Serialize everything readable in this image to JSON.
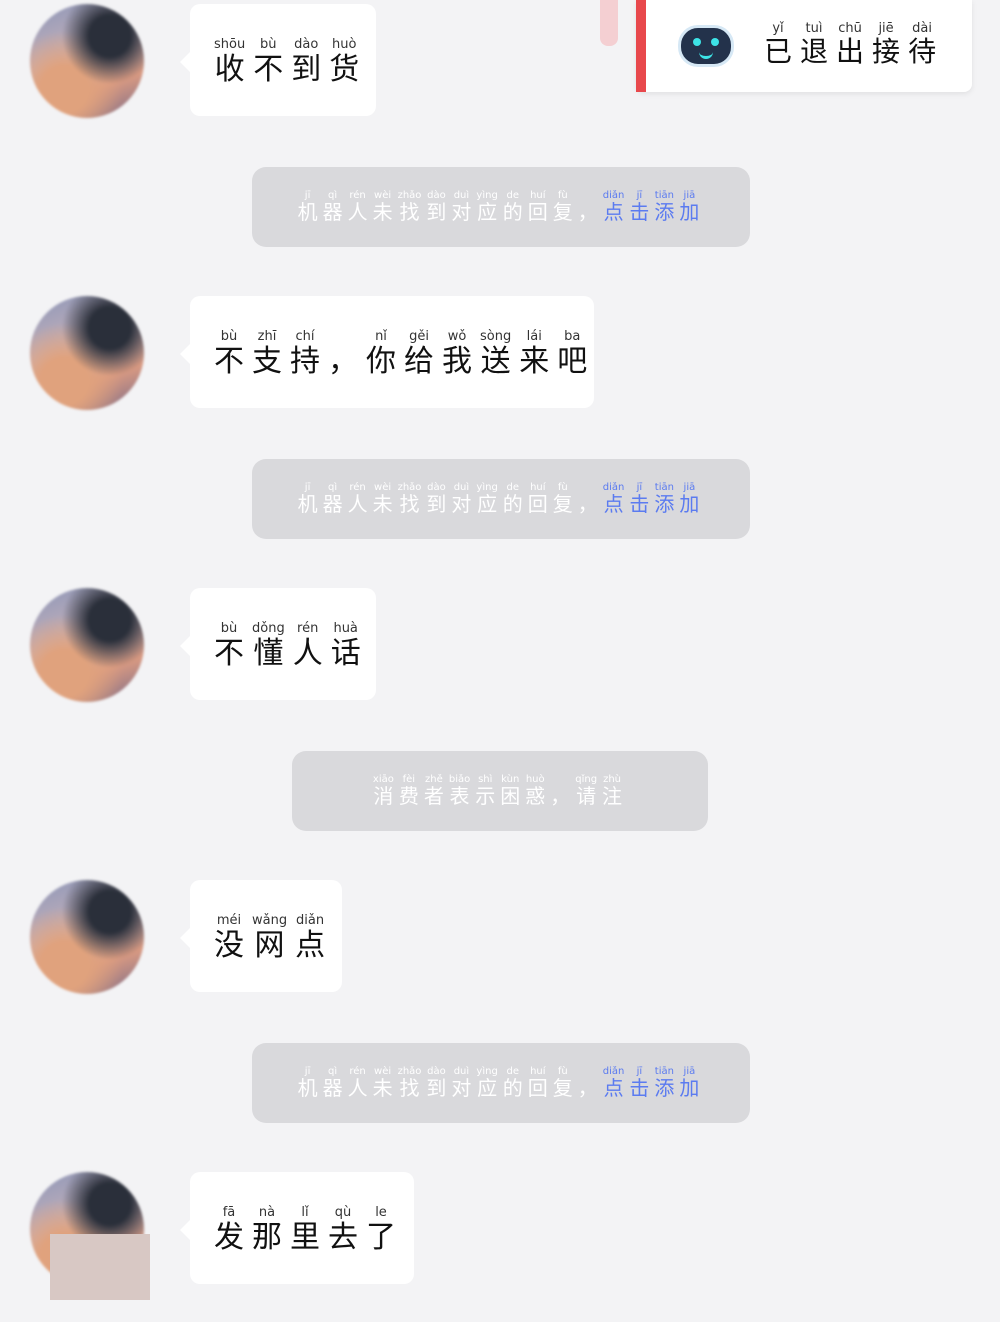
{
  "status_card": {
    "accent": "#e8484c",
    "icon": "robot-icon",
    "text": [
      [
        "已",
        "yǐ"
      ],
      [
        "退",
        "tuì"
      ],
      [
        "出",
        "chū"
      ],
      [
        "接",
        "jiē"
      ],
      [
        "待",
        "dài"
      ]
    ]
  },
  "messages": [
    {
      "type": "user",
      "text": [
        [
          "收",
          "shōu"
        ],
        [
          "不",
          "bù"
        ],
        [
          "到",
          "dào"
        ],
        [
          "货",
          "huò"
        ]
      ]
    },
    {
      "type": "system",
      "text": [
        [
          "机",
          "jī"
        ],
        [
          "器",
          "qì"
        ],
        [
          "人",
          "rén"
        ],
        [
          "未",
          "wèi"
        ],
        [
          "找",
          "zhǎo"
        ],
        [
          "到",
          "dào"
        ],
        [
          "对",
          "duì"
        ],
        [
          "应",
          "yìng"
        ],
        [
          "的",
          "de"
        ],
        [
          "回",
          "huí"
        ],
        [
          "复",
          "fù"
        ],
        [
          "，",
          ""
        ]
      ],
      "link": [
        [
          "点",
          "diǎn"
        ],
        [
          "击",
          "jī"
        ],
        [
          "添",
          "tiān"
        ],
        [
          "加",
          "jiā"
        ]
      ]
    },
    {
      "type": "user",
      "text": [
        [
          "不",
          "bù"
        ],
        [
          "支",
          "zhī"
        ],
        [
          "持",
          "chí"
        ],
        [
          "，",
          ""
        ],
        [
          "你",
          "nǐ"
        ],
        [
          "给",
          "gěi"
        ],
        [
          "我",
          "wǒ"
        ],
        [
          "送",
          "sòng"
        ],
        [
          "来",
          "lái"
        ],
        [
          "吧",
          "ba"
        ]
      ]
    },
    {
      "type": "system",
      "text": [
        [
          "机",
          "jī"
        ],
        [
          "器",
          "qì"
        ],
        [
          "人",
          "rén"
        ],
        [
          "未",
          "wèi"
        ],
        [
          "找",
          "zhǎo"
        ],
        [
          "到",
          "dào"
        ],
        [
          "对",
          "duì"
        ],
        [
          "应",
          "yìng"
        ],
        [
          "的",
          "de"
        ],
        [
          "回",
          "huí"
        ],
        [
          "复",
          "fù"
        ],
        [
          "，",
          ""
        ]
      ],
      "link": [
        [
          "点",
          "diǎn"
        ],
        [
          "击",
          "jī"
        ],
        [
          "添",
          "tiān"
        ],
        [
          "加",
          "jiā"
        ]
      ]
    },
    {
      "type": "user",
      "text": [
        [
          "不",
          "bù"
        ],
        [
          "懂",
          "dǒng"
        ],
        [
          "人",
          "rén"
        ],
        [
          "话",
          "huà"
        ]
      ]
    },
    {
      "type": "system",
      "text": [
        [
          "消",
          "xiāo"
        ],
        [
          "费",
          "fèi"
        ],
        [
          "者",
          "zhě"
        ],
        [
          "表",
          "biǎo"
        ],
        [
          "示",
          "shì"
        ],
        [
          "困",
          "kùn"
        ],
        [
          "惑",
          "huò"
        ],
        [
          "，",
          ""
        ],
        [
          "请",
          "qǐng"
        ],
        [
          "注",
          "zhù"
        ]
      ],
      "link": []
    },
    {
      "type": "user",
      "text": [
        [
          "没",
          "méi"
        ],
        [
          "网",
          "wǎng"
        ],
        [
          "点",
          "diǎn"
        ]
      ]
    },
    {
      "type": "system",
      "text": [
        [
          "机",
          "jī"
        ],
        [
          "器",
          "qì"
        ],
        [
          "人",
          "rén"
        ],
        [
          "未",
          "wèi"
        ],
        [
          "找",
          "zhǎo"
        ],
        [
          "到",
          "dào"
        ],
        [
          "对",
          "duì"
        ],
        [
          "应",
          "yìng"
        ],
        [
          "的",
          "de"
        ],
        [
          "回",
          "huí"
        ],
        [
          "复",
          "fù"
        ],
        [
          "，",
          ""
        ]
      ],
      "link": [
        [
          "点",
          "diǎn"
        ],
        [
          "击",
          "jī"
        ],
        [
          "添",
          "tiān"
        ],
        [
          "加",
          "jiā"
        ]
      ]
    },
    {
      "type": "user",
      "text": [
        [
          "发",
          "fā"
        ],
        [
          "那",
          "nà"
        ],
        [
          "里",
          "lǐ"
        ],
        [
          "去",
          "qù"
        ],
        [
          "了",
          "le"
        ]
      ]
    }
  ]
}
